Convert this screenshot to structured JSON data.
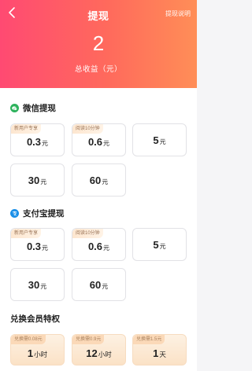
{
  "header": {
    "title": "提现",
    "rules_link": "提现说明",
    "amount": "2",
    "amount_label": "总收益（元）"
  },
  "wechat": {
    "title": "微信提现",
    "options": [
      {
        "tag": "新用户专享",
        "value": "0.3",
        "unit": "元"
      },
      {
        "tag": "阅读10分钟",
        "value": "0.6",
        "unit": "元"
      },
      {
        "tag": "",
        "value": "5",
        "unit": "元"
      },
      {
        "tag": "",
        "value": "30",
        "unit": "元"
      },
      {
        "tag": "",
        "value": "60",
        "unit": "元"
      }
    ]
  },
  "alipay": {
    "title": "支付宝提现",
    "options": [
      {
        "tag": "新用户专享",
        "value": "0.3",
        "unit": "元"
      },
      {
        "tag": "阅读10分钟",
        "value": "0.6",
        "unit": "元"
      },
      {
        "tag": "",
        "value": "5",
        "unit": "元"
      },
      {
        "tag": "",
        "value": "30",
        "unit": "元"
      },
      {
        "tag": "",
        "value": "60",
        "unit": "元"
      }
    ]
  },
  "vip": {
    "title": "兑换会员特权",
    "options": [
      {
        "tag": "兑换需0.08元",
        "value": "1",
        "unit": "小时"
      },
      {
        "tag": "兑换需0.9元",
        "value": "12",
        "unit": "小时"
      },
      {
        "tag": "兑换需1.5元",
        "value": "1",
        "unit": "天"
      }
    ]
  },
  "colors": {
    "header_start": "#ff4a72",
    "header_end": "#ff8e57",
    "wechat_icon": "#2db25c",
    "alipay_icon": "#1a8fe8",
    "vip_card": "#fbe2c6"
  }
}
